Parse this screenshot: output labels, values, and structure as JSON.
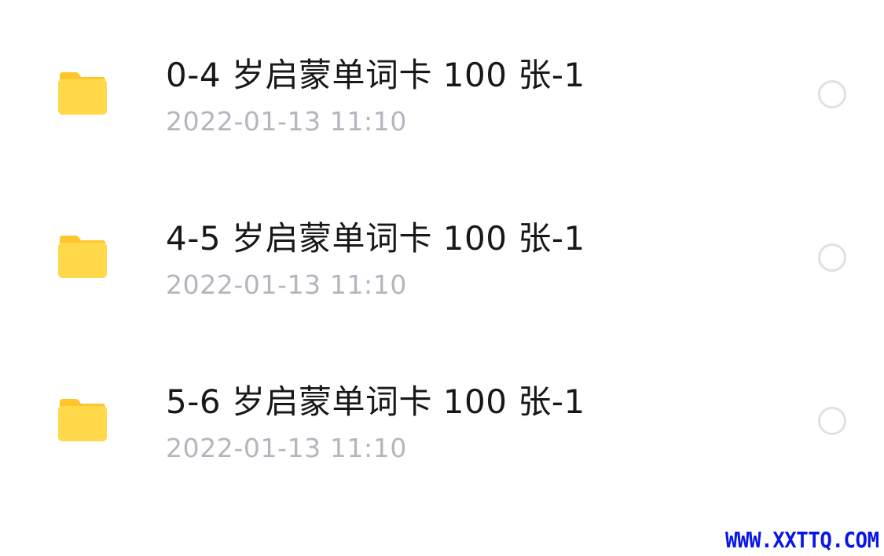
{
  "files": [
    {
      "icon": "folder-icon",
      "name": "0-4 岁启蒙单词卡 100 张-1",
      "date": "2022-01-13 11:10",
      "selected": false
    },
    {
      "icon": "folder-icon",
      "name": "4-5 岁启蒙单词卡 100 张-1",
      "date": "2022-01-13 11:10",
      "selected": false
    },
    {
      "icon": "folder-icon",
      "name": "5-6 岁启蒙单词卡 100 张-1",
      "date": "2022-01-13 11:10",
      "selected": false
    }
  ],
  "watermark": "WWW.XXTTQ.COM",
  "colors": {
    "folder_body": "#FFD94A",
    "folder_tab": "#FFC62B",
    "title_text": "#17181A",
    "date_text": "#B3B6BD",
    "radio_border": "#DFE1E6",
    "watermark": "#0A16E8"
  }
}
